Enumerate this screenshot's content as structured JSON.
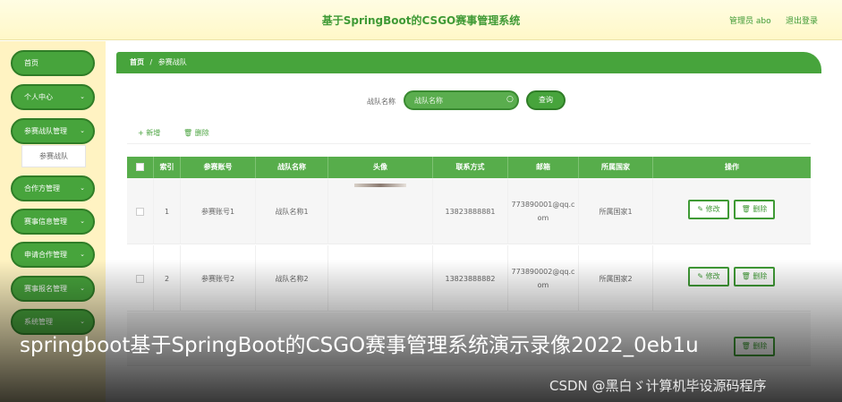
{
  "header": {
    "title": "基于SpringBoot的CSGO赛事管理系统",
    "user": "管理员 abo",
    "logout": "退出登录"
  },
  "sidebar": {
    "items": [
      {
        "label": "首页",
        "chevron": ""
      },
      {
        "label": "个人中心",
        "chevron": "⌄"
      },
      {
        "label": "参赛战队管理",
        "chevron": "⌄"
      },
      {
        "label": "合作方管理",
        "chevron": "⌄"
      },
      {
        "label": "赛事信息管理",
        "chevron": "⌄"
      },
      {
        "label": "申请合作管理",
        "chevron": "⌄"
      },
      {
        "label": "赛事报名管理",
        "chevron": "⌄"
      },
      {
        "label": "系统管理",
        "chevron": "⌄"
      }
    ],
    "submenu": "参赛战队"
  },
  "breadcrumb": {
    "home": "首页",
    "sep": "/",
    "current": "参赛战队"
  },
  "search": {
    "label": "战队名称",
    "placeholder": "战队名称",
    "button": "查询"
  },
  "actions": {
    "add": "+ 新增",
    "delete": "🗑 删除"
  },
  "table": {
    "columns": [
      "",
      "索引",
      "参赛账号",
      "战队名称",
      "头像",
      "联系方式",
      "邮箱",
      "所属国家",
      "操作"
    ],
    "rows": [
      {
        "index": "1",
        "account": "参赛账号1",
        "team": "战队名称1",
        "phone": "13823888881",
        "email": "773890001@qq.c\nom",
        "country": "所属国家1"
      },
      {
        "index": "2",
        "account": "参赛账号2",
        "team": "战队名称2",
        "phone": "13823888882",
        "email": "773890002@qq.c\nom",
        "country": "所属国家2"
      }
    ],
    "edit_label": "✎ 修改",
    "delete_label": "🗑 删除"
  },
  "overlay": {
    "title": "springboot基于SpringBoot的CSGO赛事管理系统演示录像2022_0eb1u",
    "watermark": "CSDN @黑白ゞ计算机毕设源码程序"
  }
}
